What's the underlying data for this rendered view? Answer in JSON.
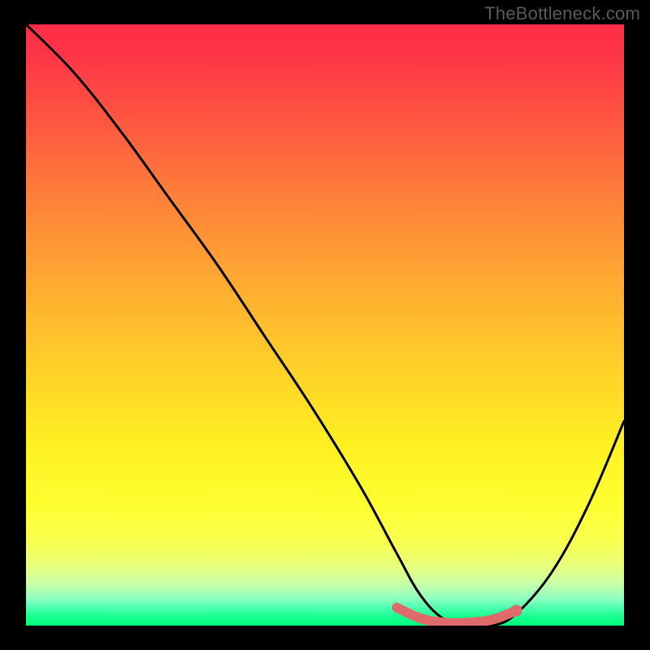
{
  "watermark": "TheBottleneck.com",
  "chart_data": {
    "type": "line",
    "title": "",
    "xlabel": "",
    "ylabel": "",
    "xlim": [
      0,
      100
    ],
    "ylim": [
      0,
      100
    ],
    "series": [
      {
        "name": "bottleneck-curve",
        "x": [
          0,
          8,
          16,
          24,
          32,
          40,
          48,
          56,
          62,
          66,
          70,
          74,
          78,
          82,
          88,
          94,
          100
        ],
        "values": [
          100,
          92,
          82,
          71,
          60,
          48,
          36,
          23,
          12,
          5,
          1,
          0,
          0,
          2,
          9,
          20,
          34
        ]
      }
    ],
    "highlight_segment": {
      "name": "optimal-range",
      "x": [
        62,
        66,
        70,
        74,
        78,
        82
      ],
      "values": [
        3.0,
        1.2,
        0.5,
        0.5,
        1.0,
        2.5
      ],
      "color": "#e06a6a"
    },
    "gradient_stops": [
      {
        "pos": 0.0,
        "color": "#ff2b48"
      },
      {
        "pos": 0.5,
        "color": "#ffd228"
      },
      {
        "pos": 0.8,
        "color": "#feff30"
      },
      {
        "pos": 1.0,
        "color": "#00ff7a"
      }
    ]
  }
}
